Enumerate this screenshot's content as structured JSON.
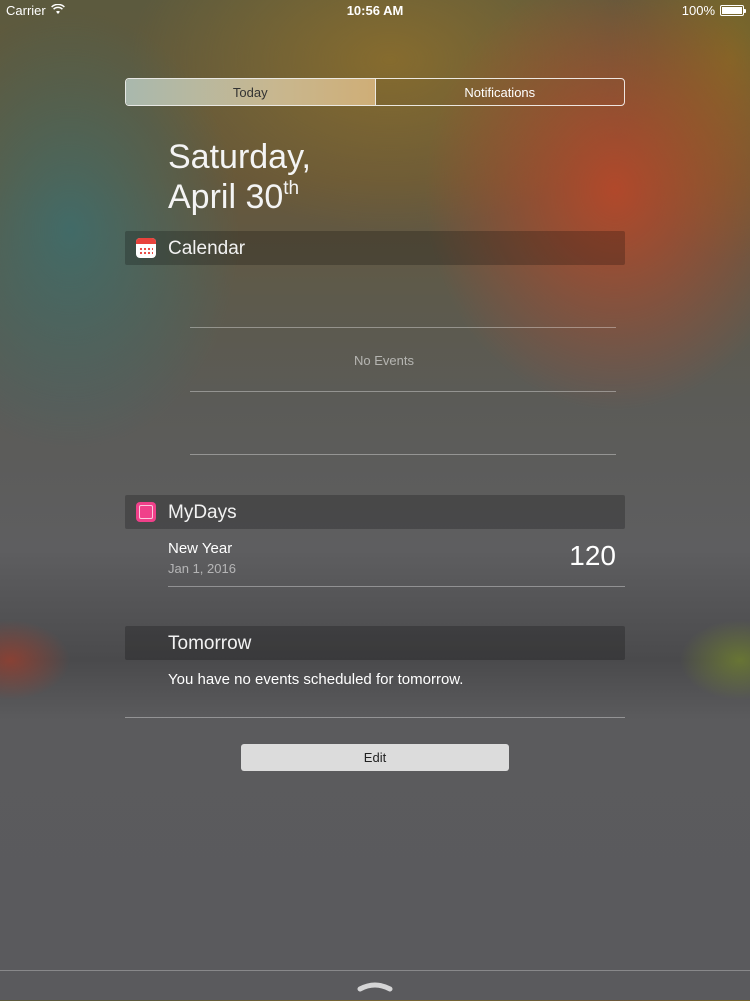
{
  "status_bar": {
    "carrier": "Carrier",
    "time": "10:56 AM",
    "battery_text": "100%",
    "battery_level": 1.0
  },
  "tabs": [
    {
      "label": "Today",
      "selected": true
    },
    {
      "label": "Notifications",
      "selected": false
    }
  ],
  "date": {
    "line1": "Saturday,",
    "line2": "April 30",
    "suffix": "th"
  },
  "calendar_widget": {
    "title": "Calendar",
    "icon": "calendar-icon",
    "empty_text": "No Events"
  },
  "mydays_widget": {
    "title": "MyDays",
    "icon": "mydays-icon",
    "accent": "#f0408a",
    "event": {
      "name": "New Year",
      "date": "Jan 1, 2016",
      "count": "120"
    }
  },
  "tomorrow_widget": {
    "title": "Tomorrow",
    "message": "You have no events scheduled for tomorrow."
  },
  "edit_label": "Edit",
  "colors": {
    "segment_selected": "#c8b78f",
    "calendar_red": "#e8423c",
    "text_primary": "#ffffff"
  }
}
